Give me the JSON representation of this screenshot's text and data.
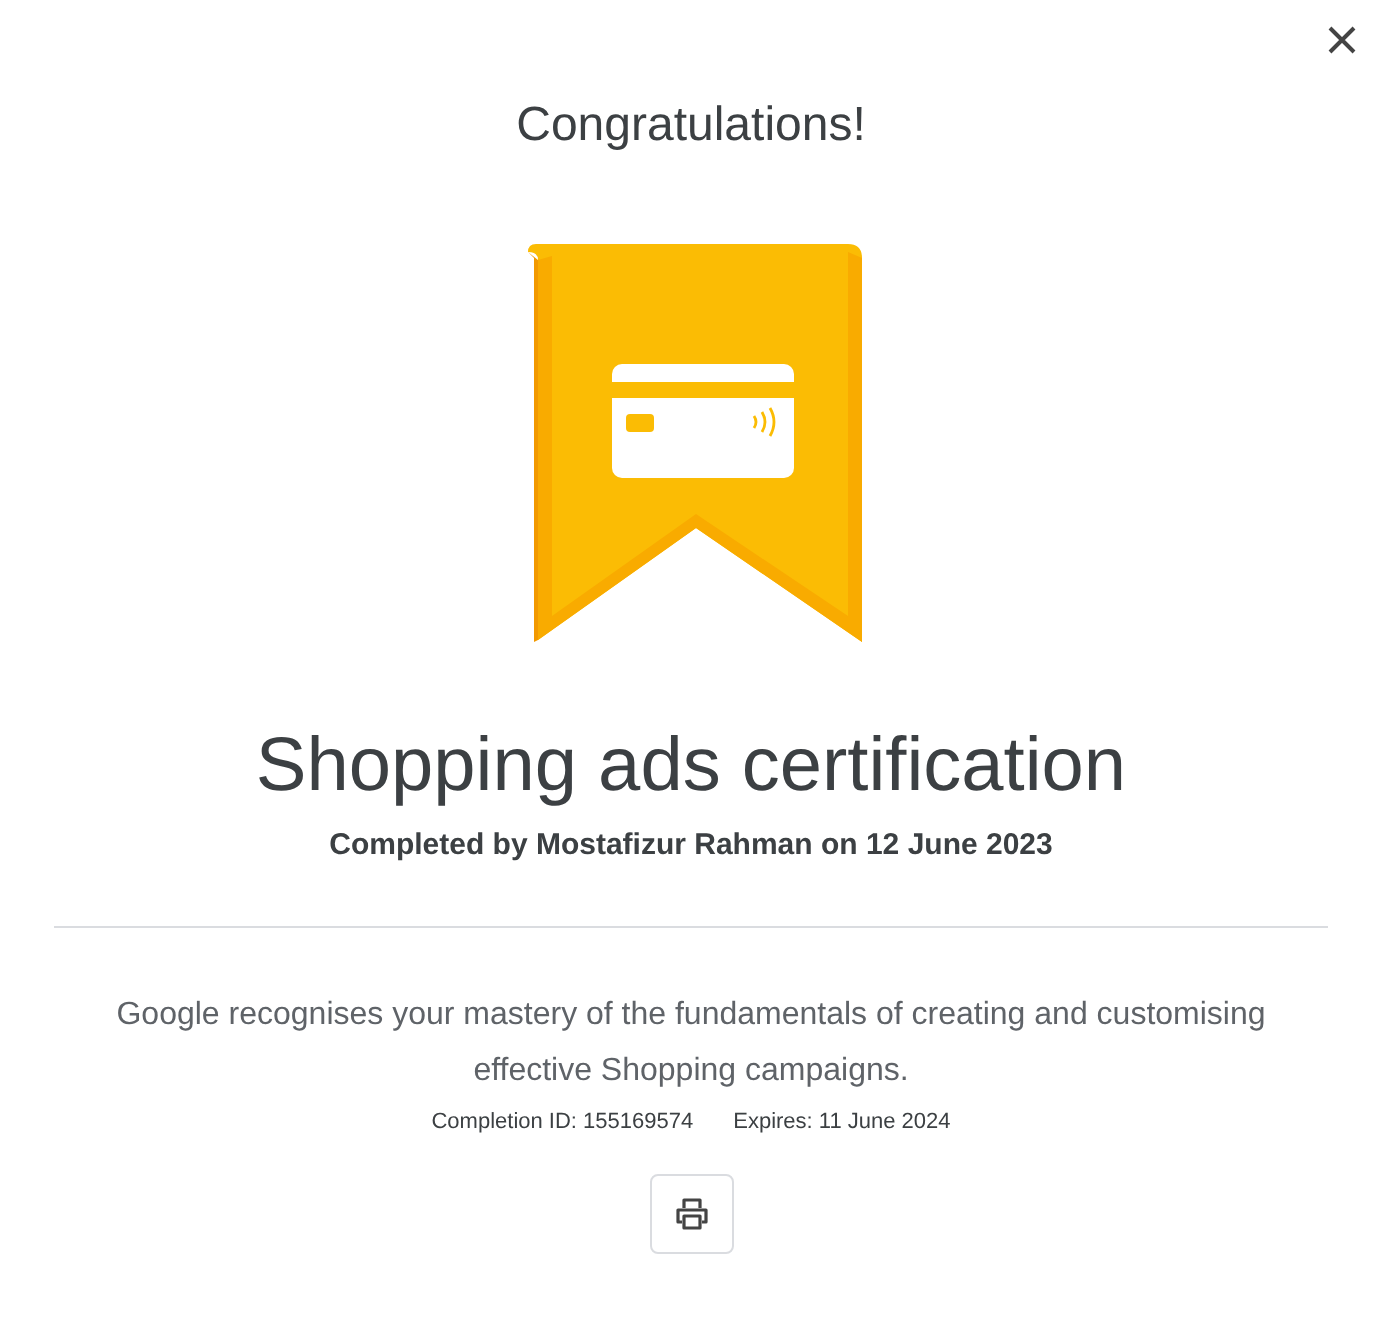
{
  "dialog": {
    "heading": "Congratulations!",
    "certificate": "Shopping ads certification",
    "completed_by": "Completed by Mostafizur Rahman on 12 June 2023",
    "description": "Google recognises your mastery of the fundamentals of creating and customising effective Shopping campaigns.",
    "completion_id": "Completion ID: 155169574",
    "expires": "Expires: 11 June 2024"
  }
}
